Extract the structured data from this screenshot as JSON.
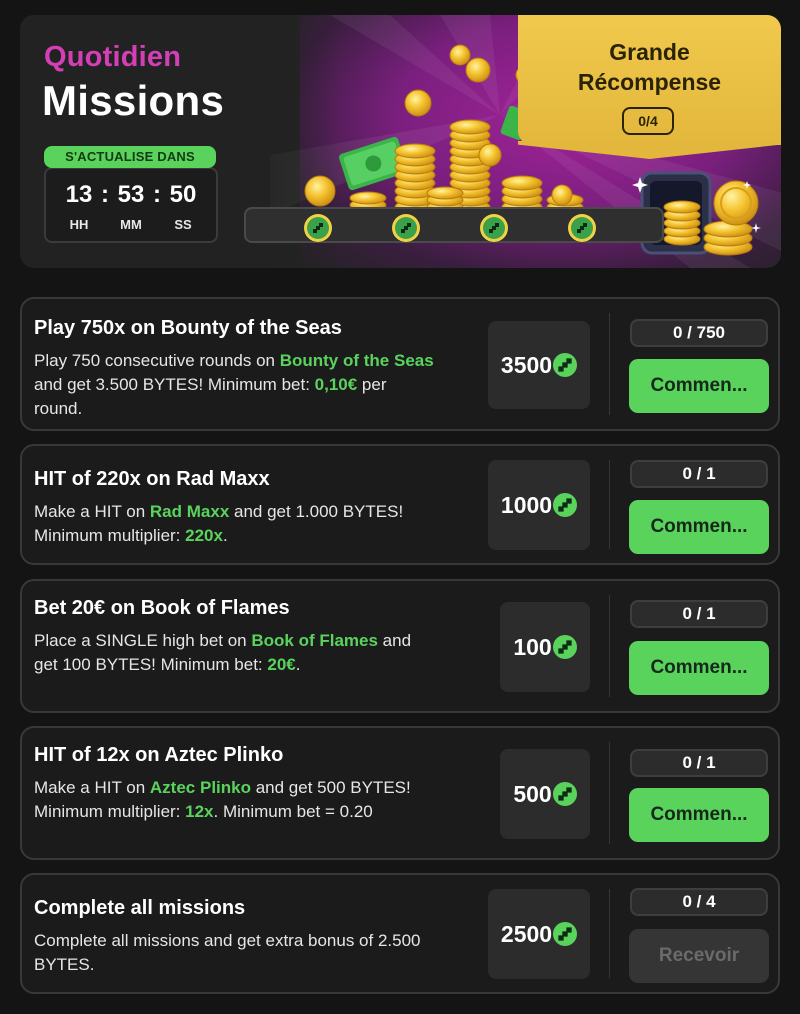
{
  "hero": {
    "subtitle": "Quotidien",
    "title": "Missions",
    "refresh_label": "S'ACTUALISE DANS",
    "timer": {
      "hours": "13",
      "minutes": "53",
      "seconds": "50",
      "sep": ":",
      "hours_label": "HH",
      "minutes_label": "MM",
      "seconds_label": "SS"
    },
    "grand_reward": {
      "title_line1": "Grande",
      "title_line2": "Récompense",
      "count": "0/4"
    },
    "progress_nodes": 4
  },
  "colors": {
    "accent_green": "#5ad35d",
    "accent_pink": "#d43fb8",
    "gold": "#f0c94d",
    "card_bg": "#1b1b1b",
    "page_bg": "#141414"
  },
  "missions": [
    {
      "title": "Play 750x on Bounty of the Seas",
      "desc": [
        {
          "t": "Play 750 consecutive rounds on "
        },
        {
          "t": "Bounty of the Seas",
          "hl": true
        },
        {
          "t": " and get 3.500 BYTES! Minimum bet: "
        },
        {
          "t": "0,10€",
          "hl": true
        },
        {
          "t": " per round."
        }
      ],
      "reward": "3500",
      "progress": "0 / 750",
      "button": "Commen..."
    },
    {
      "title": "HIT of 220x on Rad Maxx",
      "desc": [
        {
          "t": "Make a HIT on "
        },
        {
          "t": "Rad Maxx",
          "hl": true
        },
        {
          "t": " and get 1.000 BYTES! Minimum multiplier: "
        },
        {
          "t": "220x",
          "hl": true
        },
        {
          "t": "."
        }
      ],
      "reward": "1000",
      "progress": "0 / 1",
      "button": "Commen..."
    },
    {
      "title": "Bet 20€ on Book of Flames",
      "desc": [
        {
          "t": "Place a SINGLE high bet on "
        },
        {
          "t": "Book of Flames",
          "hl": true
        },
        {
          "t": " and get 100 BYTES! Minimum bet: "
        },
        {
          "t": "20€",
          "hl": true
        },
        {
          "t": "."
        }
      ],
      "reward": "100",
      "progress": "0 / 1",
      "button": "Commen..."
    },
    {
      "title": "HIT of 12x on Aztec Plinko",
      "desc": [
        {
          "t": "Make a HIT on "
        },
        {
          "t": "Aztec Plinko",
          "hl": true
        },
        {
          "t": " and get 500 BYTES! Minimum multiplier: "
        },
        {
          "t": "12x",
          "hl": true
        },
        {
          "t": ". Minimum bet = 0.20"
        }
      ],
      "reward": "500",
      "progress": "0 / 1",
      "button": "Commen..."
    },
    {
      "title": "Complete all missions",
      "desc": [
        {
          "t": "Complete all missions and get extra bonus of 2.500 BYTES."
        }
      ],
      "reward": "2500",
      "progress": "0 / 4",
      "button": "Recevoir",
      "disabled": true
    }
  ]
}
